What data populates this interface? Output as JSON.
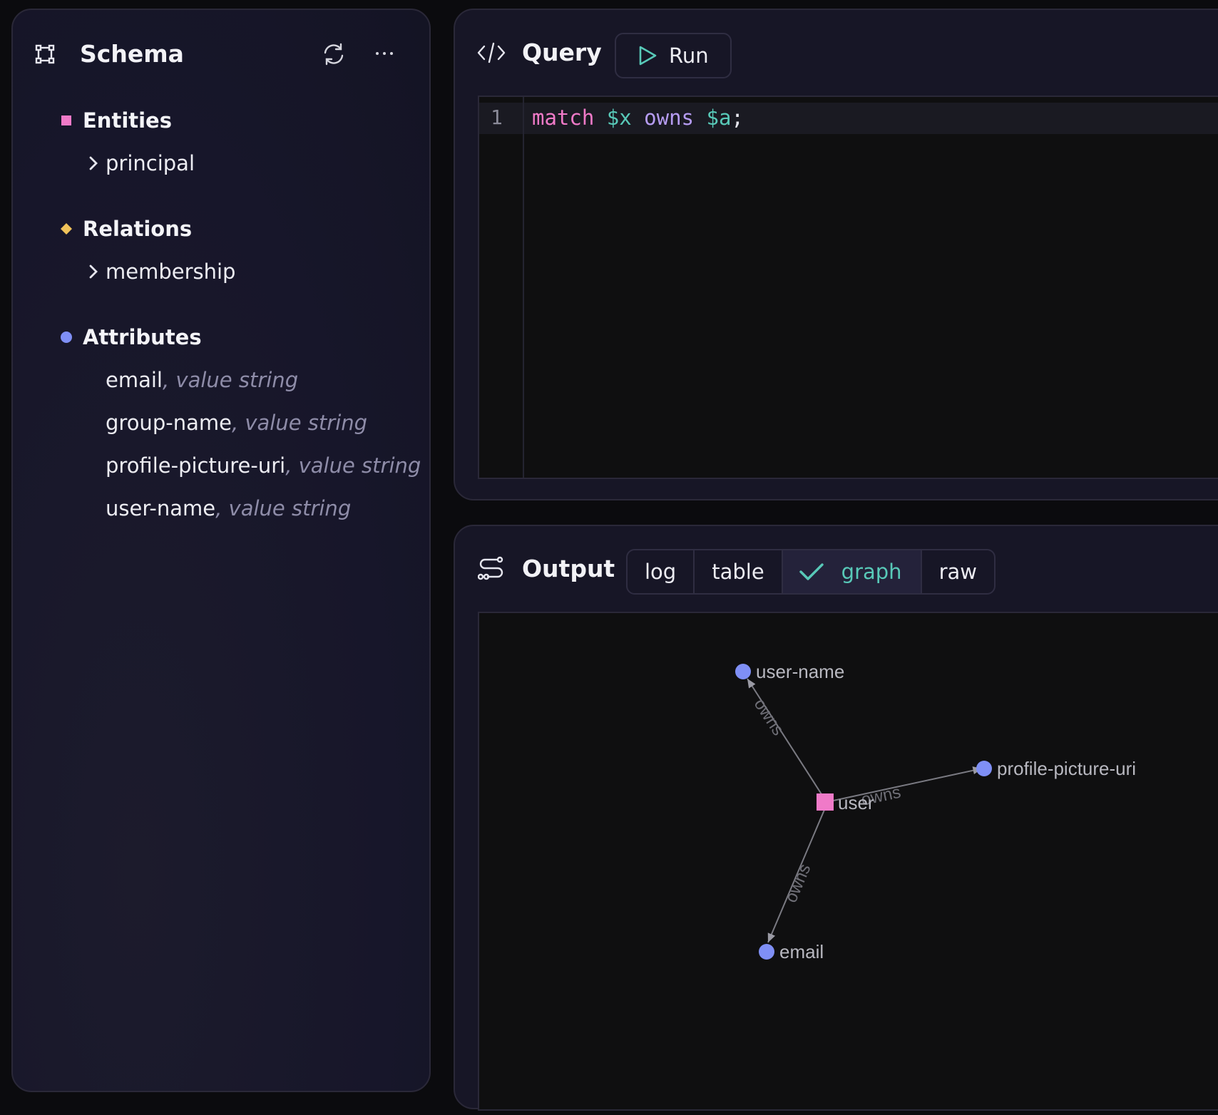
{
  "schema": {
    "title": "Schema",
    "sections": [
      {
        "title": "Entities",
        "items": [
          "principal"
        ]
      },
      {
        "title": "Relations",
        "items": [
          "membership"
        ]
      },
      {
        "title": "Attributes",
        "items": [
          {
            "name": "email",
            "type": ", value string"
          },
          {
            "name": "group-name",
            "type": ", value string"
          },
          {
            "name": "profile-picture-uri",
            "type": ", value string"
          },
          {
            "name": "user-name",
            "type": ", value string"
          }
        ]
      }
    ]
  },
  "query": {
    "title": "Query",
    "run_label": "Run",
    "line_number": "1",
    "code_tokens": {
      "kw1": "match",
      "v1": "$x",
      "kw2": "owns",
      "v2": "$a",
      "end": ";"
    }
  },
  "output": {
    "title": "Output",
    "tabs": [
      "log",
      "table",
      "graph",
      "raw"
    ],
    "active_tab": "graph",
    "graph": {
      "nodes": {
        "center": "user",
        "n1": "user-name",
        "n2": "profile-picture-uri",
        "n3": "email"
      },
      "edge_label": "owns"
    }
  },
  "colors": {
    "entity": "#f07ac8",
    "relation": "#f0c25a",
    "attribute": "#7f8ff5",
    "keyword_pink": "#f07ac8",
    "var_teal": "#58c9b8",
    "keyword_purple": "#b69cf2",
    "accent_teal": "#58c9b8"
  }
}
